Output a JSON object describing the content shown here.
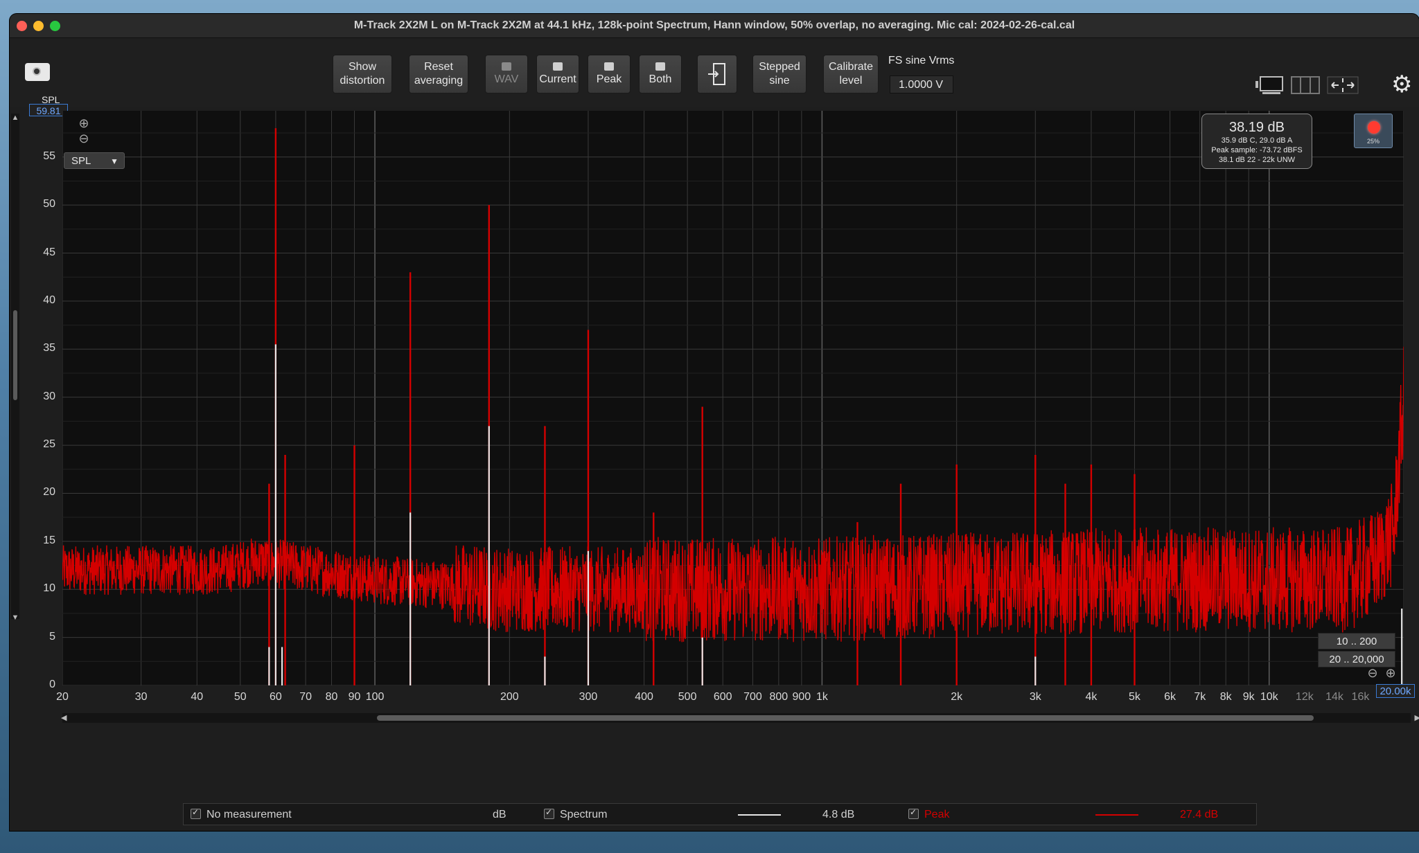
{
  "window": {
    "title": "M-Track 2X2M  L on M-Track 2X2M at 44.1 kHz, 128k-point Spectrum, Hann window, 50% overlap, no averaging. Mic cal: 2024-02-26-cal.cal"
  },
  "toolbar": {
    "show_distortion": [
      "Show",
      "distortion"
    ],
    "reset_averaging": [
      "Reset",
      "averaging"
    ],
    "wav": "WAV",
    "current": "Current",
    "peak": "Peak",
    "both": "Both",
    "stepped_sine": [
      "Stepped",
      "sine"
    ],
    "calibrate_level": [
      "Calibrate",
      "level"
    ],
    "fs_sine_label": "FS sine Vrms",
    "fs_sine_value": "1.0000 V"
  },
  "plot": {
    "yaxis_title": "SPL",
    "ymax_value": "59.81",
    "selector": "SPL",
    "xmax_value": "20.00k",
    "range_buttons": [
      "10 .. 200",
      "20 .. 20,000"
    ],
    "record_pct": "25%"
  },
  "readout": {
    "main": "38.19 dB",
    "line1": "35.9 dB C, 29.0 dB A",
    "line2": "Peak sample: -73.72 dBFS",
    "line3": "38.1 dB 22 - 22k UNW"
  },
  "legend": {
    "no_measurement": "No measurement",
    "unit": "dB",
    "spectrum": "Spectrum",
    "spectrum_value": "4.8 dB",
    "peak": "Peak",
    "peak_value": "27.4 dB"
  },
  "colors": {
    "peak": "#d40000",
    "spectrum": "#e6e6e6",
    "grid": "#3a3a3a"
  },
  "chart_data": {
    "type": "line",
    "title": "",
    "xlabel": "",
    "ylabel": "SPL",
    "xscale": "log",
    "xlim": [
      20,
      20000
    ],
    "ylim": [
      0,
      59.81
    ],
    "grid": true,
    "x_tick_labels": [
      "20",
      "30",
      "40",
      "50",
      "60",
      "70",
      "80",
      "90",
      "100",
      "200",
      "300",
      "400",
      "500",
      "600",
      "700",
      "800",
      "900",
      "1k",
      "2k",
      "3k",
      "4k",
      "5k",
      "6k",
      "7k",
      "8k",
      "9k",
      "10k",
      "12k",
      "14k",
      "16k"
    ],
    "y_tick_labels": [
      "0",
      "5",
      "10",
      "15",
      "20",
      "25",
      "30",
      "35",
      "40",
      "45",
      "50",
      "55"
    ],
    "series": [
      {
        "name": "Peak",
        "noise_floor": [
          [
            20,
            12
          ],
          [
            30,
            12
          ],
          [
            45,
            12
          ],
          [
            55,
            13
          ],
          [
            100,
            11
          ],
          [
            200,
            10
          ],
          [
            1000,
            10
          ],
          [
            5000,
            11
          ],
          [
            15000,
            11
          ],
          [
            17500,
            13
          ],
          [
            19000,
            16
          ],
          [
            20000,
            30
          ]
        ],
        "peaks": [
          [
            58,
            21
          ],
          [
            60,
            58
          ],
          [
            63,
            24
          ],
          [
            90,
            25
          ],
          [
            120,
            43
          ],
          [
            180,
            50
          ],
          [
            240,
            27
          ],
          [
            300,
            37
          ],
          [
            420,
            18
          ],
          [
            540,
            29
          ],
          [
            1200,
            17
          ],
          [
            1500,
            21
          ],
          [
            2000,
            23
          ],
          [
            3000,
            24
          ],
          [
            3500,
            21
          ],
          [
            4000,
            23
          ],
          [
            5000,
            22
          ]
        ]
      },
      {
        "name": "Spectrum",
        "peaks": [
          [
            58,
            4
          ],
          [
            60,
            35.5
          ],
          [
            62,
            4
          ],
          [
            120,
            18
          ],
          [
            180,
            27
          ],
          [
            240,
            3
          ],
          [
            300,
            14
          ],
          [
            540,
            5
          ],
          [
            3000,
            3
          ],
          [
            19800,
            8
          ]
        ]
      }
    ]
  }
}
